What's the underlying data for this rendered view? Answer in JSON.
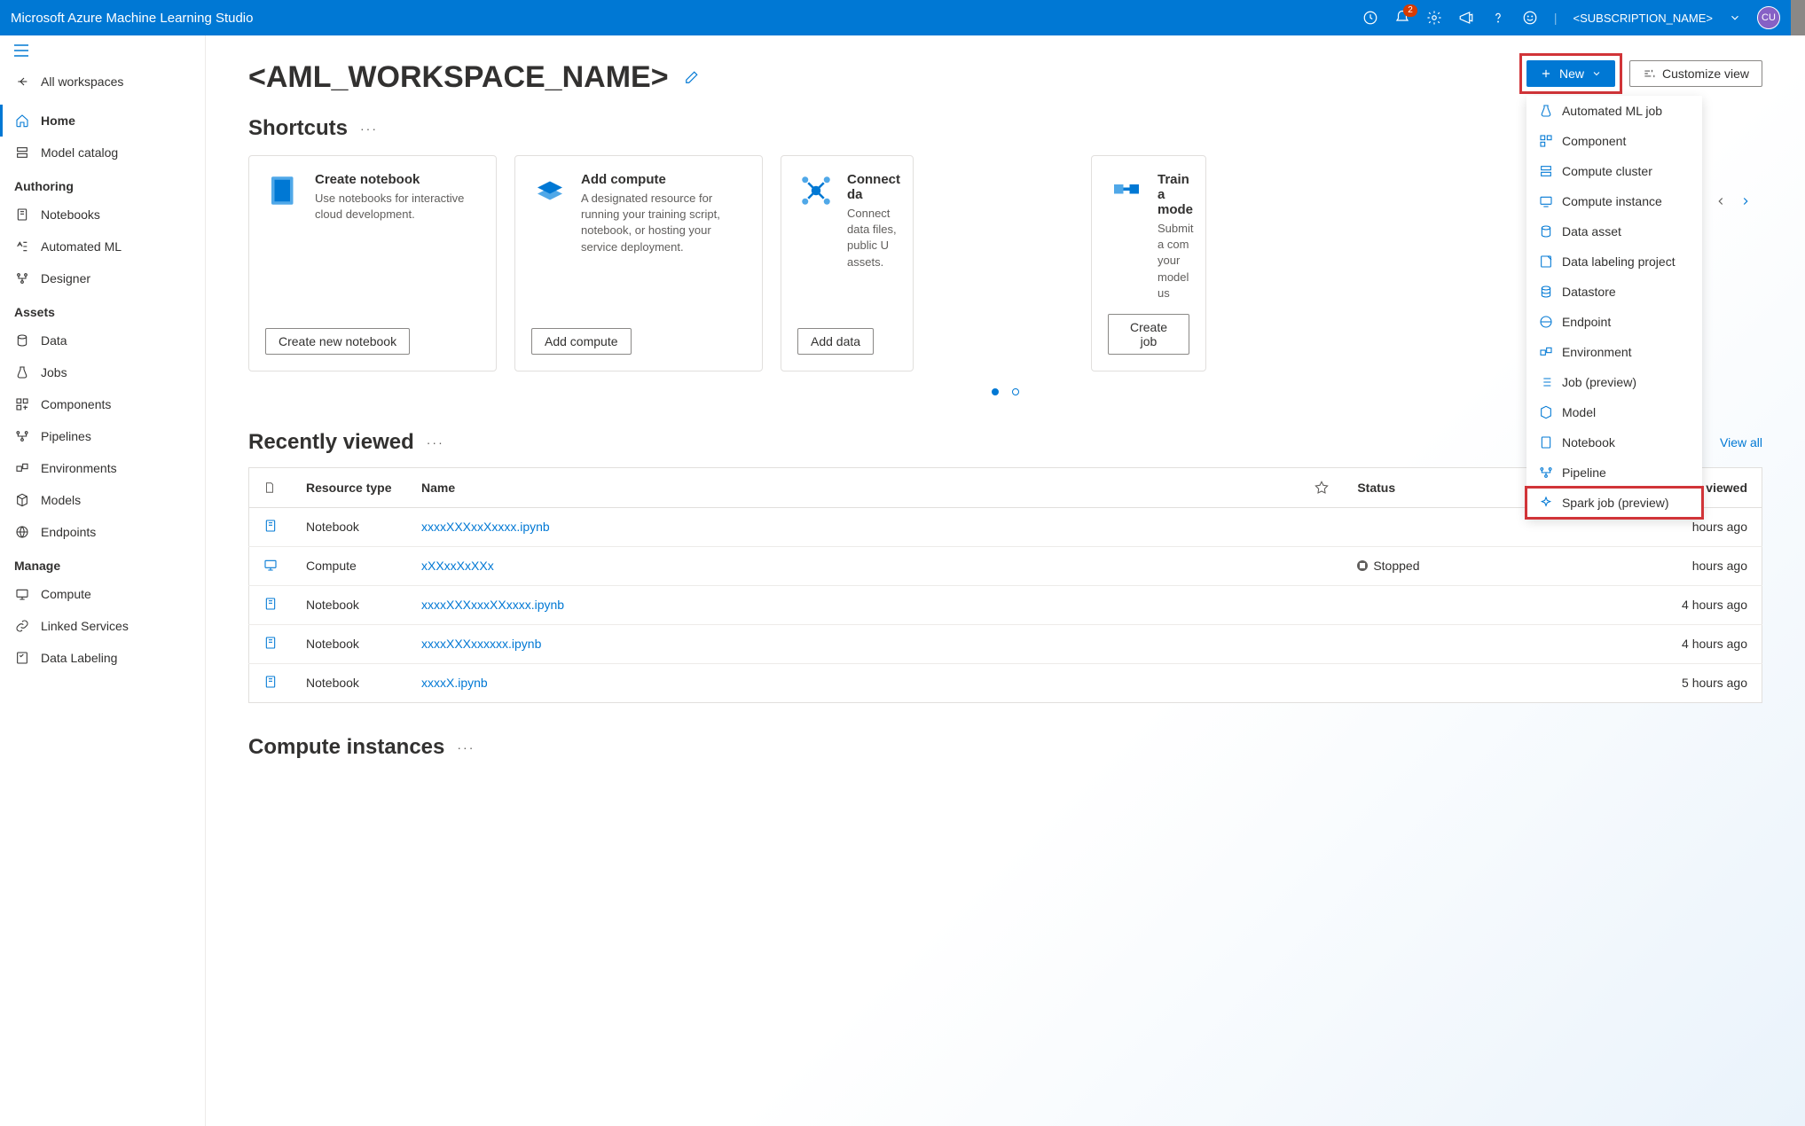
{
  "header": {
    "product": "Microsoft Azure Machine Learning Studio",
    "notification_count": "2",
    "subscription": "<SUBSCRIPTION_NAME>",
    "avatar_initials": "CU"
  },
  "sidebar": {
    "all_workspaces": "All workspaces",
    "home": "Home",
    "model_catalog": "Model catalog",
    "section_authoring": "Authoring",
    "notebooks": "Notebooks",
    "automated_ml": "Automated ML",
    "designer": "Designer",
    "section_assets": "Assets",
    "data": "Data",
    "jobs": "Jobs",
    "components": "Components",
    "pipelines": "Pipelines",
    "environments": "Environments",
    "models": "Models",
    "endpoints": "Endpoints",
    "section_manage": "Manage",
    "compute": "Compute",
    "linked_services": "Linked Services",
    "data_labeling": "Data Labeling"
  },
  "workspace": {
    "title": "<AML_WORKSPACE_NAME>",
    "new_button": "New",
    "customize_view": "Customize view"
  },
  "new_menu": {
    "items": [
      "Automated ML job",
      "Component",
      "Compute cluster",
      "Compute instance",
      "Data asset",
      "Data labeling project",
      "Datastore",
      "Endpoint",
      "Environment",
      "Job (preview)",
      "Model",
      "Notebook",
      "Pipeline",
      "Spark job (preview)"
    ]
  },
  "shortcuts": {
    "heading": "Shortcuts",
    "cards": [
      {
        "title": "Create notebook",
        "desc": "Use notebooks for interactive cloud development.",
        "action": "Create new notebook"
      },
      {
        "title": "Add compute",
        "desc": "A designated resource for running your training script, notebook, or hosting your service deployment.",
        "action": "Add compute"
      },
      {
        "title": "Connect da",
        "desc": "Connect data files, public U assets.",
        "action": "Add data"
      },
      {
        "title": "Train a mode",
        "desc": "Submit a com your model us",
        "action": "Create job"
      }
    ]
  },
  "recently_viewed": {
    "heading": "Recently viewed",
    "view_all": "View all",
    "columns": {
      "resource_type": "Resource type",
      "name": "Name",
      "status": "Status",
      "last_viewed": "Last viewed"
    },
    "rows": [
      {
        "type": "Notebook",
        "name": "xxxxXXXxxXxxxx.ipynb",
        "status": "",
        "last_viewed": "hours ago"
      },
      {
        "type": "Compute",
        "name": "xXXxxXxXXx",
        "status": "Stopped",
        "last_viewed": "hours ago"
      },
      {
        "type": "Notebook",
        "name": "xxxxXXXxxxXXxxxx.ipynb",
        "status": "",
        "last_viewed": "4 hours ago"
      },
      {
        "type": "Notebook",
        "name": "xxxxXXXxxxxxx.ipynb",
        "status": "",
        "last_viewed": "4 hours ago"
      },
      {
        "type": "Notebook",
        "name": "xxxxX.ipynb",
        "status": "",
        "last_viewed": "5 hours ago"
      }
    ]
  },
  "compute_instances": {
    "heading": "Compute instances"
  }
}
